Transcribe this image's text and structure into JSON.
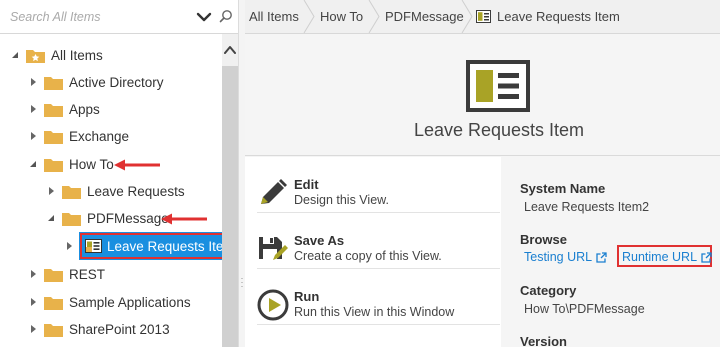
{
  "search": {
    "placeholder": "Search All Items"
  },
  "tree": {
    "items": [
      {
        "label": "All Items"
      },
      {
        "label": "Active Directory"
      },
      {
        "label": "Apps"
      },
      {
        "label": "Exchange"
      },
      {
        "label": "How To"
      },
      {
        "label": "Leave Requests"
      },
      {
        "label": "PDFMessage"
      },
      {
        "label": "Leave Requests Item"
      },
      {
        "label": "REST"
      },
      {
        "label": "Sample Applications"
      },
      {
        "label": "SharePoint 2013"
      }
    ]
  },
  "breadcrumb": {
    "items": [
      "All Items",
      "How To",
      "PDFMessage",
      "Leave Requests Item"
    ]
  },
  "header": {
    "title": "Leave Requests Item"
  },
  "actions": [
    {
      "title": "Edit",
      "desc": "Design this View."
    },
    {
      "title": "Save As",
      "desc": "Create a copy of this View."
    },
    {
      "title": "Run",
      "desc": "Run this View in this Window"
    }
  ],
  "details": {
    "system_name_label": "System Name",
    "system_name_value": "Leave Requests Item2",
    "browse_label": "Browse",
    "testing_url": "Testing URL",
    "runtime_url": "Runtime URL",
    "category_label": "Category",
    "category_value": "How To\\PDFMessage",
    "version_label": "Version"
  },
  "colors": {
    "folder": "#e8b24a",
    "selection": "#1a8fe0",
    "highlight_red": "#e03131",
    "link_blue": "#1a7fd0",
    "icon_olive": "#a9a326",
    "icon_dark": "#3b3b3b"
  }
}
